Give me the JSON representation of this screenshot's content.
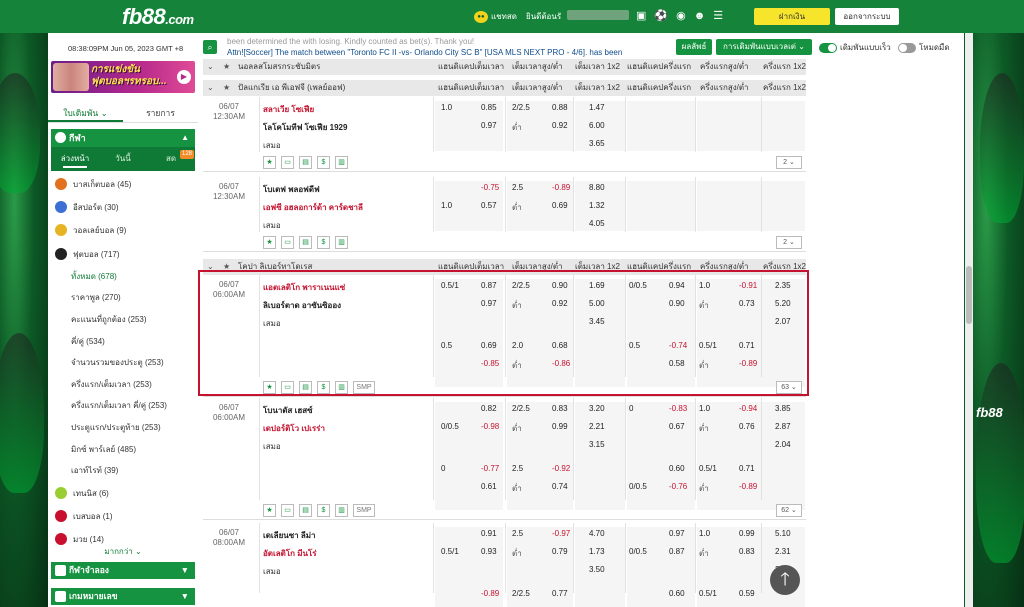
{
  "header": {
    "logo_main": "fb88",
    "logo_tld": ".com",
    "chat_label": "แชทสด",
    "welcome": "ยินดีต้อนรั",
    "deposit": "ฝากเงิน",
    "logout": "ออกจากระบบ"
  },
  "left": {
    "clock": "08:38:09PM Jun 05, 2023 GMT +8",
    "banner_text_1": "การแข่งขัน",
    "banner_text_2": "ฟุตบอลฯรทรอบ...",
    "tabs": [
      "ใบเดิมพัน",
      "รายการ"
    ],
    "sports_header": "กีฬา",
    "subtabs": [
      "ล่วงหน้า",
      "วันนี้",
      "สด"
    ],
    "live_count": "128",
    "sports": [
      {
        "label": "บาสเก็ตบอล (45)",
        "color": "#e2711d"
      },
      {
        "label": "อีสปอร์ต (30)",
        "color": "#3b6fd3"
      },
      {
        "label": "วอลเลย์บอล (9)",
        "color": "#e6b325"
      },
      {
        "label": "ฟุตบอล (717)",
        "color": "#222222"
      }
    ],
    "football_subs": [
      "ทั้งหมด (678)",
      "ราคาพูล (270)",
      "คะแนนที่ถูกต้อง (253)",
      "คี่/คู่ (534)",
      "จำนวนรวมของประตู (253)",
      "ครึ่งแรก/เต็มเวลา (253)",
      "ครึ่งแรก/เต็มเวลา คี่/คู่ (253)",
      "ประตูแรก/ประตูท้าย (253)",
      "มิกซ์ พาร์เลย์ (485)",
      "เอาท์ไรท์ (39)"
    ],
    "sports_after": [
      {
        "label": "เทนนิส (6)",
        "color": "#9acd32"
      },
      {
        "label": "เบสบอล (1)",
        "color": "#c8102e"
      },
      {
        "label": "มวย (14)",
        "color": "#c8102e"
      }
    ],
    "more": "มากกว่า",
    "section_virtual": "กีฬาจำลอง",
    "section_numbers": "เกมหมายเลข"
  },
  "main": {
    "ticker_line1": "been determined the with losing. Kindly counted as bet(s). Thank you!",
    "ticker_line2": "Attn![Soccer] The match between \"Toronto FC II -vs- Orlando City SC B\" [USA MLS NEXT PRO - 4/6]. has been",
    "results_btn": "ผลลัพธ์",
    "betset_btn": "การเดิมพันแบบเวลเต่",
    "toggle_quick": "เดิมพันแบบเร็ว",
    "toggle_night": "โหมดมืด",
    "col_headers": [
      "แฮนดิแคปเต็มเวลา",
      "เต็มเวลาสูง/ต่ำ",
      "เต็มเวลา 1x2",
      "แฮนดิแคปครึ่งแรก",
      "ครึ่งแรกสูง/ต่ำ",
      "ครึ่งแรก 1x2"
    ],
    "leagues": [
      {
        "name": "นอลลสโมสรกระชับมิตร"
      },
      {
        "name": "ปัลแกเรีย เอ พีเอฟจี (เพลย์ออฟ)"
      },
      {
        "name": "โคปา ลิเบอร์ทาโดเรส"
      }
    ],
    "matches": [
      {
        "date": "06/07",
        "time": "12:30AM",
        "home": "สลาเวีย โซเฟีย",
        "away": "โลโคโมทีฟ โซเฟีย 1929",
        "draw": "เสมอ",
        "hdp": [
          "1.0",
          "0.85",
          "",
          "0.97"
        ],
        "ou": [
          "2/2.5",
          "0.88",
          "ต่ำ",
          "0.92"
        ],
        "x12": [
          "1.47",
          "6.00",
          "3.65"
        ],
        "more": "2"
      },
      {
        "date": "06/07",
        "time": "12:30AM",
        "home": "โบเตฟ พลอฟดีฟ",
        "away": "เอฟซี อฮลอการ์ด้า คาร์ดชาลี",
        "draw": "เสมอ",
        "hdp": [
          "",
          "-0.75",
          "1.0",
          "0.57"
        ],
        "ou": [
          "2.5",
          "-0.89",
          "ต่ำ",
          "0.69"
        ],
        "x12": [
          "8.80",
          "1.32",
          "4.05"
        ],
        "more": "2"
      },
      {
        "date": "06/07",
        "time": "06:00AM",
        "home": "แอตเลติโก พาราเนนแซ่",
        "away": "ลิเบอร์ตาด อาซันซิออง",
        "draw": "เสมอ",
        "hdp": [
          "0.5/1",
          "0.87",
          "",
          "0.97"
        ],
        "ou": [
          "2/2.5",
          "0.90",
          "ต่ำ",
          "0.92"
        ],
        "x12": [
          "1.69",
          "5.00",
          "3.45"
        ],
        "fh_hdp": [
          "0/0.5",
          "0.94",
          "",
          "0.90"
        ],
        "fh_ou": [
          "1.0",
          "-0.91",
          "ต่ำ",
          "0.73"
        ],
        "fh_x12": [
          "2.35",
          "5.20",
          "2.07"
        ],
        "alt_hdp": [
          "0.5",
          "0.69",
          "",
          "-0.85"
        ],
        "alt_ou": [
          "2.0",
          "0.68",
          "ต่ำ",
          "-0.86"
        ],
        "alt_fh_hdp": [
          "0.5",
          "-0.74",
          "",
          "0.58"
        ],
        "alt_fh_ou": [
          "0.5/1",
          "0.71",
          "ต่ำ",
          "-0.89"
        ],
        "more": "63",
        "smp": "SMP"
      },
      {
        "date": "06/07",
        "time": "06:00AM",
        "home": "โบนาดัส เฮสซ์",
        "away": "เดปอร์ติโว เปเรร่า",
        "draw": "เสมอ",
        "hdp": [
          "",
          "0.82",
          "0/0.5",
          "-0.98"
        ],
        "ou": [
          "2/2.5",
          "0.83",
          "ต่ำ",
          "0.99"
        ],
        "x12": [
          "3.20",
          "2.21",
          "3.15"
        ],
        "fh_hdp": [
          "0",
          "-0.83",
          "",
          "0.67"
        ],
        "fh_ou": [
          "1.0",
          "-0.94",
          "ต่ำ",
          "0.76"
        ],
        "fh_x12": [
          "3.85",
          "2.87",
          "2.04"
        ],
        "alt_hdp": [
          "0",
          "-0.77",
          "",
          "0.61"
        ],
        "alt_ou": [
          "2.5",
          "-0.92",
          "ต่ำ",
          "0.74"
        ],
        "alt_fh_hdp": [
          "",
          "0.60",
          "0/0.5",
          "-0.76"
        ],
        "alt_fh_ou": [
          "0.5/1",
          "0.71",
          "ต่ำ",
          "-0.89"
        ],
        "more": "62",
        "smp": "SMP"
      },
      {
        "date": "06/07",
        "time": "08:00AM",
        "home": "เดเลียนซา ลีม่า",
        "away": "อัตเลติโก มีนโร่",
        "draw": "เสมอ",
        "hdp": [
          "",
          "0.91",
          "0.5/1",
          "0.93"
        ],
        "ou": [
          "2.5",
          "-0.97",
          "ต่ำ",
          "0.79"
        ],
        "x12": [
          "4.70",
          "1.73",
          "3.50"
        ],
        "fh_hdp": [
          "",
          "0.97",
          "0/0.5",
          "0.87"
        ],
        "fh_ou": [
          "1.0",
          "0.99",
          "ต่ำ",
          "0.83"
        ],
        "fh_x12": [
          "5.10",
          "2.31",
          "2.13"
        ],
        "alt_hdp": [
          "",
          "-0.89",
          "",
          ""
        ],
        "alt_ou": [
          "2/2.5",
          "0.77",
          "",
          ""
        ],
        "alt_fh_hdp": [
          "",
          "0.60",
          "",
          ""
        ],
        "alt_fh_ou": [
          "0.5/1",
          "0.59",
          "",
          ""
        ]
      }
    ]
  }
}
